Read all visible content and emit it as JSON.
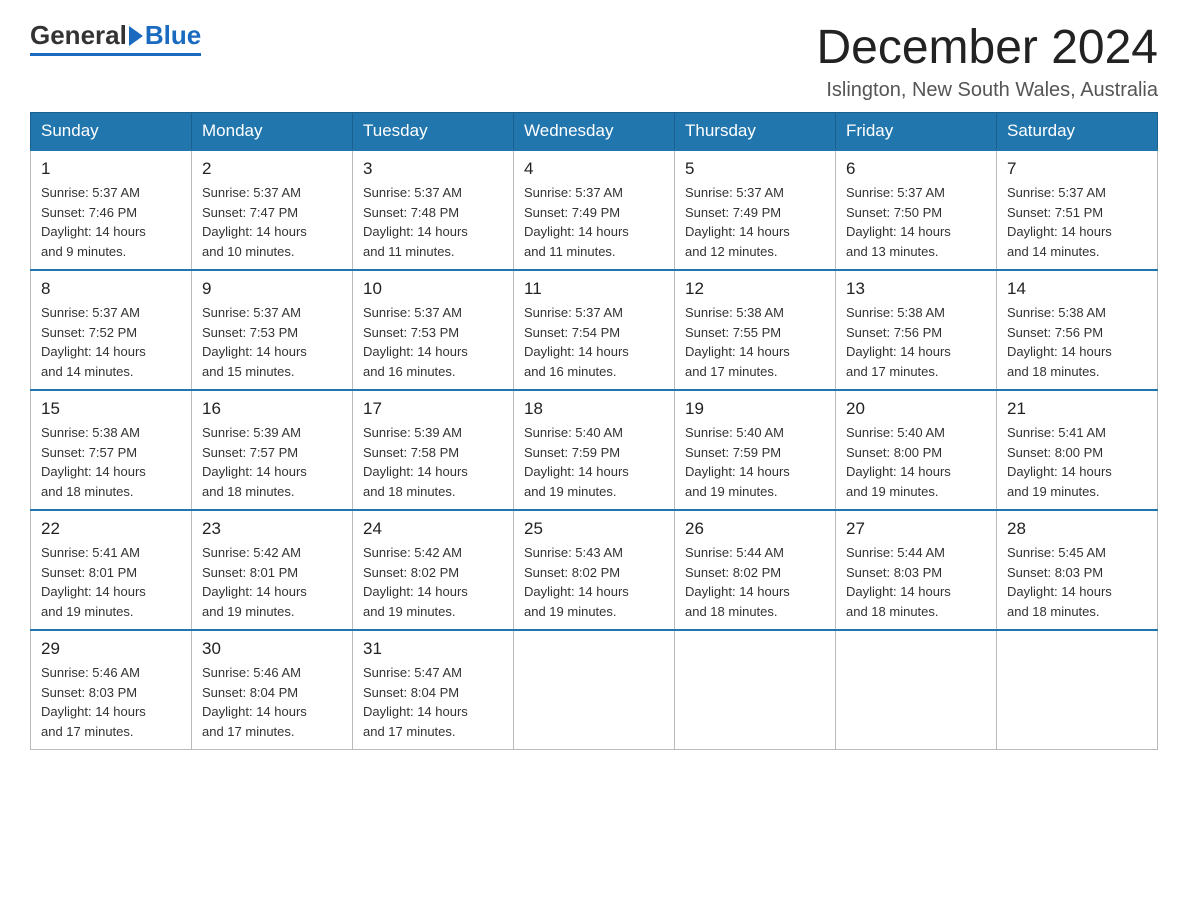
{
  "header": {
    "logo": {
      "part1": "General",
      "part2": "Blue"
    },
    "title": "December 2024",
    "location": "Islington, New South Wales, Australia"
  },
  "calendar": {
    "days_of_week": [
      "Sunday",
      "Monday",
      "Tuesday",
      "Wednesday",
      "Thursday",
      "Friday",
      "Saturday"
    ],
    "weeks": [
      [
        {
          "day": 1,
          "sunrise": "5:37 AM",
          "sunset": "7:46 PM",
          "daylight": "14 hours and 9 minutes."
        },
        {
          "day": 2,
          "sunrise": "5:37 AM",
          "sunset": "7:47 PM",
          "daylight": "14 hours and 10 minutes."
        },
        {
          "day": 3,
          "sunrise": "5:37 AM",
          "sunset": "7:48 PM",
          "daylight": "14 hours and 11 minutes."
        },
        {
          "day": 4,
          "sunrise": "5:37 AM",
          "sunset": "7:49 PM",
          "daylight": "14 hours and 11 minutes."
        },
        {
          "day": 5,
          "sunrise": "5:37 AM",
          "sunset": "7:49 PM",
          "daylight": "14 hours and 12 minutes."
        },
        {
          "day": 6,
          "sunrise": "5:37 AM",
          "sunset": "7:50 PM",
          "daylight": "14 hours and 13 minutes."
        },
        {
          "day": 7,
          "sunrise": "5:37 AM",
          "sunset": "7:51 PM",
          "daylight": "14 hours and 14 minutes."
        }
      ],
      [
        {
          "day": 8,
          "sunrise": "5:37 AM",
          "sunset": "7:52 PM",
          "daylight": "14 hours and 14 minutes."
        },
        {
          "day": 9,
          "sunrise": "5:37 AM",
          "sunset": "7:53 PM",
          "daylight": "14 hours and 15 minutes."
        },
        {
          "day": 10,
          "sunrise": "5:37 AM",
          "sunset": "7:53 PM",
          "daylight": "14 hours and 16 minutes."
        },
        {
          "day": 11,
          "sunrise": "5:37 AM",
          "sunset": "7:54 PM",
          "daylight": "14 hours and 16 minutes."
        },
        {
          "day": 12,
          "sunrise": "5:38 AM",
          "sunset": "7:55 PM",
          "daylight": "14 hours and 17 minutes."
        },
        {
          "day": 13,
          "sunrise": "5:38 AM",
          "sunset": "7:56 PM",
          "daylight": "14 hours and 17 minutes."
        },
        {
          "day": 14,
          "sunrise": "5:38 AM",
          "sunset": "7:56 PM",
          "daylight": "14 hours and 18 minutes."
        }
      ],
      [
        {
          "day": 15,
          "sunrise": "5:38 AM",
          "sunset": "7:57 PM",
          "daylight": "14 hours and 18 minutes."
        },
        {
          "day": 16,
          "sunrise": "5:39 AM",
          "sunset": "7:57 PM",
          "daylight": "14 hours and 18 minutes."
        },
        {
          "day": 17,
          "sunrise": "5:39 AM",
          "sunset": "7:58 PM",
          "daylight": "14 hours and 18 minutes."
        },
        {
          "day": 18,
          "sunrise": "5:40 AM",
          "sunset": "7:59 PM",
          "daylight": "14 hours and 19 minutes."
        },
        {
          "day": 19,
          "sunrise": "5:40 AM",
          "sunset": "7:59 PM",
          "daylight": "14 hours and 19 minutes."
        },
        {
          "day": 20,
          "sunrise": "5:40 AM",
          "sunset": "8:00 PM",
          "daylight": "14 hours and 19 minutes."
        },
        {
          "day": 21,
          "sunrise": "5:41 AM",
          "sunset": "8:00 PM",
          "daylight": "14 hours and 19 minutes."
        }
      ],
      [
        {
          "day": 22,
          "sunrise": "5:41 AM",
          "sunset": "8:01 PM",
          "daylight": "14 hours and 19 minutes."
        },
        {
          "day": 23,
          "sunrise": "5:42 AM",
          "sunset": "8:01 PM",
          "daylight": "14 hours and 19 minutes."
        },
        {
          "day": 24,
          "sunrise": "5:42 AM",
          "sunset": "8:02 PM",
          "daylight": "14 hours and 19 minutes."
        },
        {
          "day": 25,
          "sunrise": "5:43 AM",
          "sunset": "8:02 PM",
          "daylight": "14 hours and 19 minutes."
        },
        {
          "day": 26,
          "sunrise": "5:44 AM",
          "sunset": "8:02 PM",
          "daylight": "14 hours and 18 minutes."
        },
        {
          "day": 27,
          "sunrise": "5:44 AM",
          "sunset": "8:03 PM",
          "daylight": "14 hours and 18 minutes."
        },
        {
          "day": 28,
          "sunrise": "5:45 AM",
          "sunset": "8:03 PM",
          "daylight": "14 hours and 18 minutes."
        }
      ],
      [
        {
          "day": 29,
          "sunrise": "5:46 AM",
          "sunset": "8:03 PM",
          "daylight": "14 hours and 17 minutes."
        },
        {
          "day": 30,
          "sunrise": "5:46 AM",
          "sunset": "8:04 PM",
          "daylight": "14 hours and 17 minutes."
        },
        {
          "day": 31,
          "sunrise": "5:47 AM",
          "sunset": "8:04 PM",
          "daylight": "14 hours and 17 minutes."
        },
        null,
        null,
        null,
        null
      ]
    ],
    "labels": {
      "sunrise": "Sunrise:",
      "sunset": "Sunset:",
      "daylight": "Daylight:"
    }
  }
}
